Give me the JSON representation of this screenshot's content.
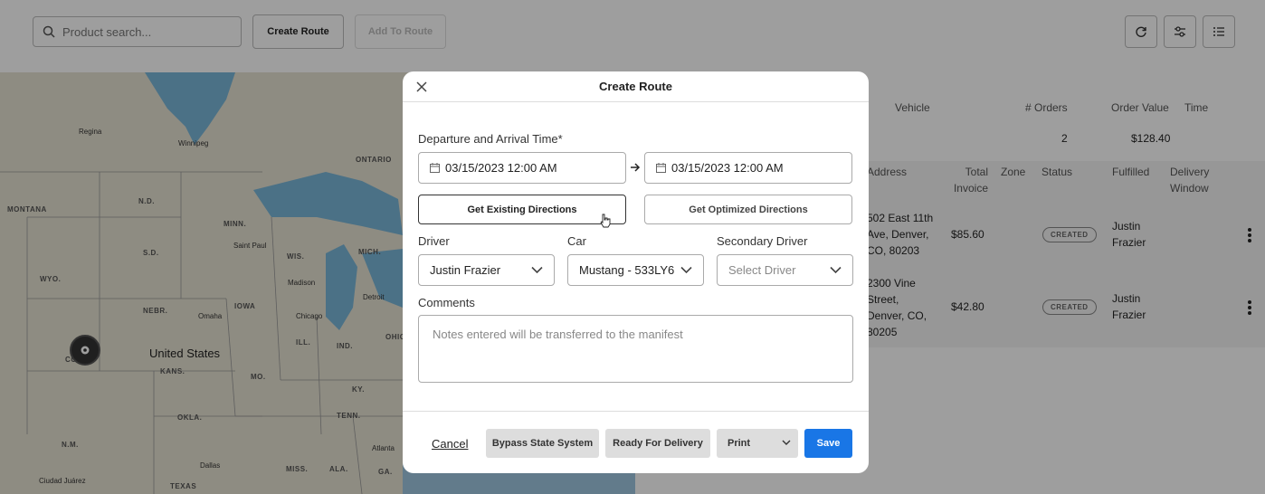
{
  "toolbar": {
    "search_placeholder": "Product search...",
    "create_route_label": "Create Route",
    "add_to_route_label": "Add To Route"
  },
  "map": {
    "country": "United States",
    "regions": [
      "ONTARIO",
      "N.D.",
      "MONTANA",
      "MINN.",
      "S.D.",
      "WIS.",
      "MICH.",
      "WYO.",
      "NEBR.",
      "IOWA",
      "ILL.",
      "IND.",
      "OHIO",
      "COLO.",
      "KANS.",
      "MO.",
      "KY.",
      "OKLA.",
      "TENN.",
      "N.M.",
      "MISS.",
      "ALA.",
      "GA.",
      "TEXAS"
    ],
    "cities": [
      "Regina",
      "Winnipeg",
      "Saint Paul",
      "Madison",
      "Detroit",
      "Omaha",
      "Chicago",
      "Atlanta",
      "Dallas",
      "Ciudad Juárez"
    ]
  },
  "summary": {
    "headers": {
      "vehicle": "Vehicle",
      "orders": "# Orders",
      "order_value": "Order Value",
      "time": "Time"
    },
    "values": {
      "orders": "2",
      "order_value": "$128.40"
    }
  },
  "orders_table": {
    "headers": {
      "address": "Address",
      "total_invoice": "Total Invoice",
      "zone": "Zone",
      "status": "Status",
      "fulfilled": "Fulfilled",
      "delivery_window": "Delivery Window"
    },
    "rows": [
      {
        "address": "502 East 11th Ave, Denver, CO, 80203",
        "total_invoice": "$85.60",
        "status": "CREATED",
        "fulfilled": "Justin Frazier"
      },
      {
        "address": "2300 Vine Street, Denver, CO, 80205",
        "total_invoice": "$42.80",
        "status": "CREATED",
        "fulfilled": "Justin Frazier"
      }
    ]
  },
  "modal": {
    "title": "Create Route",
    "departure_label": "Departure and Arrival Time*",
    "departure_value": "03/15/2023 12:00 AM",
    "arrival_value": "03/15/2023 12:00 AM",
    "existing_directions_label": "Get Existing Directions",
    "optimized_directions_label": "Get Optimized Directions",
    "driver_label": "Driver",
    "driver_value": "Justin Frazier",
    "car_label": "Car",
    "car_value": "Mustang - 533LY6",
    "secondary_driver_label": "Secondary Driver",
    "secondary_driver_placeholder": "Select Driver",
    "comments_label": "Comments",
    "comments_placeholder": "Notes entered will be transferred to the manifest",
    "cancel_label": "Cancel",
    "bypass_label": "Bypass State System",
    "ready_label": "Ready For Delivery",
    "print_label": "Print",
    "save_label": "Save"
  },
  "colors": {
    "accent": "#1976e6",
    "overlay": "rgba(0,0,0,0.38)"
  }
}
